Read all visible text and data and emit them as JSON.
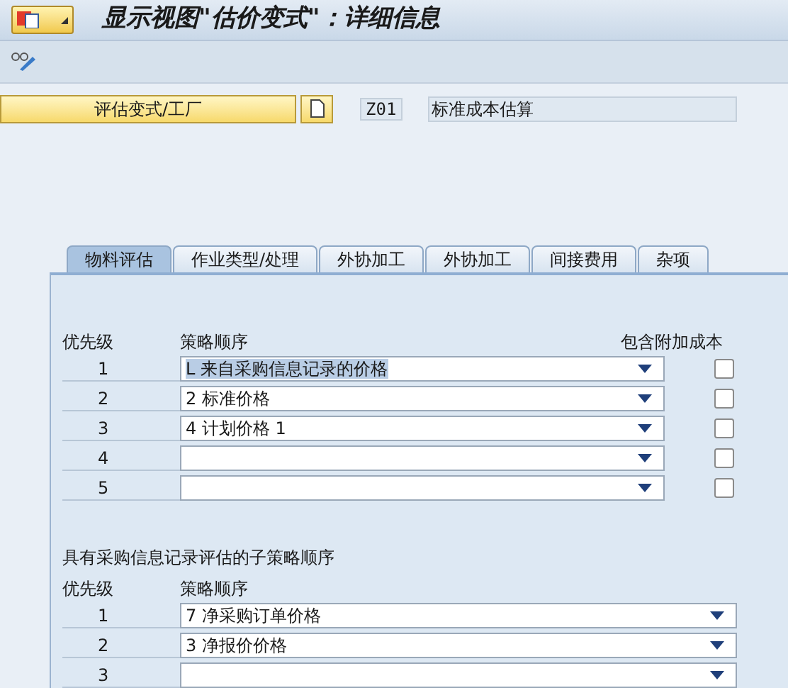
{
  "window": {
    "title": "显示视图\"估价变式\"：详细信息"
  },
  "header": {
    "button": "评估变式/工厂",
    "code": "Z01",
    "description": "标准成本估算"
  },
  "tabs": [
    {
      "label": "物料评估",
      "selected": true
    },
    {
      "label": "作业类型/处理",
      "selected": false
    },
    {
      "label": "外协加工",
      "selected": false
    },
    {
      "label": "外协加工",
      "selected": false
    },
    {
      "label": "间接费用",
      "selected": false
    },
    {
      "label": "杂项",
      "selected": false
    }
  ],
  "strategy": {
    "priority_header": "优先级",
    "sequence_header": "策略顺序",
    "cost_header": "包含附加成本",
    "rows": [
      {
        "priority": "1",
        "value": "L 来自采购信息记录的价格",
        "text_selected": true,
        "checked": false
      },
      {
        "priority": "2",
        "value": "2 标准价格",
        "text_selected": false,
        "checked": false
      },
      {
        "priority": "3",
        "value": "4 计划价格 1",
        "text_selected": false,
        "checked": false
      },
      {
        "priority": "4",
        "checked": false
      },
      {
        "priority": "5",
        "checked": false
      }
    ]
  },
  "sub_strategy": {
    "title": "具有采购信息记录评估的子策略顺序",
    "priority_header": "优先级",
    "sequence_header": "策略顺序",
    "rows": [
      {
        "priority": "1",
        "value": "7 净采购订单价格"
      },
      {
        "priority": "2",
        "value": "3 净报价价格"
      },
      {
        "priority": "3"
      }
    ]
  }
}
